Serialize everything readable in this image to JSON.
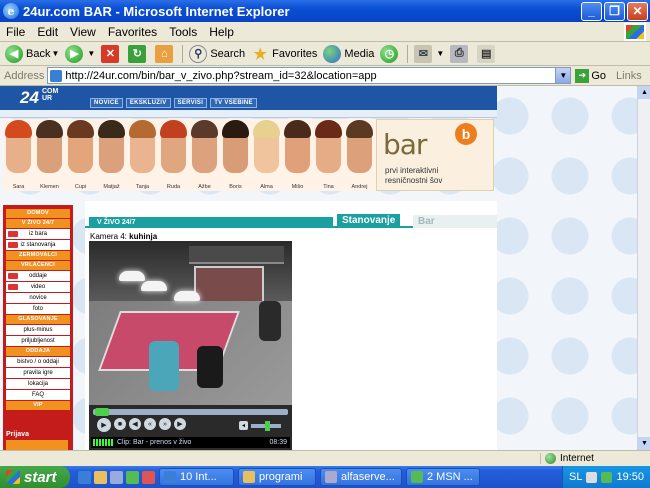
{
  "window": {
    "title": "24ur.com BAR - Microsoft Internet Explorer",
    "minimize": "_",
    "maximize": "❐",
    "close": "✕"
  },
  "menu": [
    "File",
    "Edit",
    "View",
    "Favorites",
    "Tools",
    "Help"
  ],
  "toolbar": {
    "back": "Back",
    "search": "Search",
    "favorites": "Favorites",
    "media": "Media"
  },
  "address": {
    "label": "Address",
    "url": "http://24ur.com/bin/bar_v_zivo.php?stream_id=32&location=app",
    "go": "Go",
    "links": "Links"
  },
  "site": {
    "logo": "24",
    "logo_small": "COM UR",
    "nav": [
      "NOVICE",
      "EKSKLUZIV",
      "SERVISI",
      "TV VSEBINE"
    ]
  },
  "cast": [
    {
      "name": "Sara",
      "skin": "#e8b08a",
      "hair": "#d24a1e"
    },
    {
      "name": "Klemen",
      "skin": "#d9a07a",
      "hair": "#4a3020"
    },
    {
      "name": "Cupi",
      "skin": "#e2a57c",
      "hair": "#6a3a20"
    },
    {
      "name": "Matjaž",
      "skin": "#dba07c",
      "hair": "#3a2a1a"
    },
    {
      "name": "Tanja",
      "skin": "#eab490",
      "hair": "#b46a30"
    },
    {
      "name": "Ruda",
      "skin": "#e0a680",
      "hair": "#c04020"
    },
    {
      "name": "Ažbe",
      "skin": "#dca27e",
      "hair": "#5a3a2a"
    },
    {
      "name": "Boris",
      "skin": "#d89c76",
      "hair": "#2a1a10"
    },
    {
      "name": "Alma",
      "skin": "#f0c49c",
      "hair": "#e8d090"
    },
    {
      "name": "Mišo",
      "skin": "#e0a07a",
      "hair": "#4a2a1a"
    },
    {
      "name": "Tina",
      "skin": "#e6ac86",
      "hair": "#6a2a18"
    },
    {
      "name": "Andrej",
      "skin": "#dca07a",
      "hair": "#5a3a22"
    }
  ],
  "brand": {
    "word": "bar",
    "letter": "b",
    "tagline_1": "prvi interaktivni",
    "tagline_2": "resničnostni šov"
  },
  "leftmenu": [
    {
      "type": "head",
      "label": "DOMOV"
    },
    {
      "type": "head",
      "label": "V ŽIVO 24/7"
    },
    {
      "type": "item",
      "label": "iz bara",
      "icon": true
    },
    {
      "type": "item",
      "label": "iz stanovanja",
      "icon": true
    },
    {
      "type": "head",
      "label": "ZERMOVALCI"
    },
    {
      "type": "head",
      "label": "VRLAČENCI"
    },
    {
      "type": "item",
      "label": "oddaje",
      "icon": true
    },
    {
      "type": "item",
      "label": "video",
      "icon": true
    },
    {
      "type": "item",
      "label": "novice"
    },
    {
      "type": "item",
      "label": "foto"
    },
    {
      "type": "head",
      "label": "GLASOVANJE"
    },
    {
      "type": "item",
      "label": "plus-minus"
    },
    {
      "type": "item",
      "label": "priljubljenost"
    },
    {
      "type": "head",
      "label": "ODDAJA"
    },
    {
      "type": "item",
      "label": "bistvo / o oddaji"
    },
    {
      "type": "item",
      "label": "pravila igre"
    },
    {
      "type": "item",
      "label": "lokacija"
    },
    {
      "type": "item",
      "label": "FAQ"
    },
    {
      "type": "head",
      "label": "VIP"
    }
  ],
  "leftmenu_footer": "Prijava",
  "content": {
    "live_label": "V ŽIVO 24/7",
    "tab_active": "Stanovanje",
    "tab_inactive": "Bar",
    "camera_prefix": "Kamera 4:",
    "camera_name": "kuhinja"
  },
  "player": {
    "clip": "Clip: Bar - prenos v živo",
    "time": "08:39"
  },
  "statusbar": {
    "zone": "Internet"
  },
  "taskbar": {
    "start": "start",
    "tasks": [
      {
        "label": "10 Int..."
      },
      {
        "label": "programi"
      },
      {
        "label": "alfaserve..."
      },
      {
        "label": "2 MSN ..."
      }
    ],
    "tray_lang": "SL",
    "clock": "19:50"
  }
}
